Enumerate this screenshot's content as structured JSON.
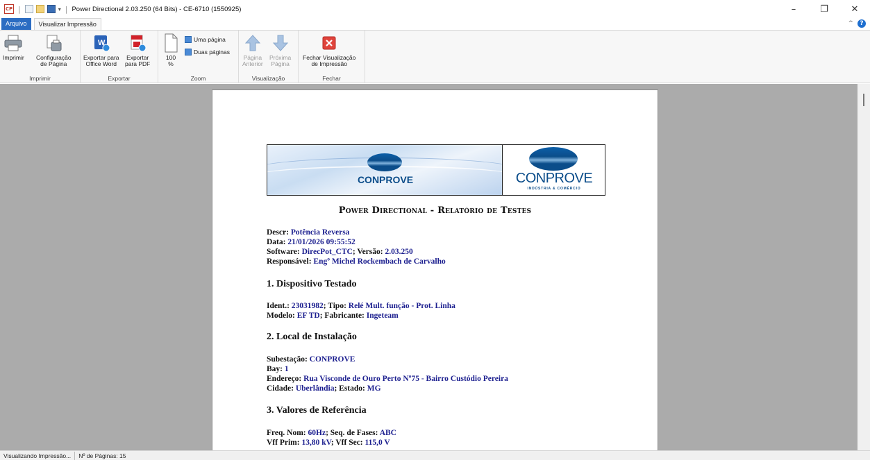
{
  "titlebar": {
    "app_icon_text": "CP",
    "title": "Power Directional 2.03.250 (64 Bits) - CE-6710 (1550925)",
    "minimize": "–",
    "restore": "❐",
    "close": "✕"
  },
  "tabs": {
    "file": "Arquivo",
    "active": "Visualizar Impressão"
  },
  "ribbon": {
    "print_group": {
      "label": "Imprimir",
      "print": "Imprimir",
      "page_config_1": "Configuração",
      "page_config_2": "de Página"
    },
    "export_group": {
      "label": "Exportar",
      "word_1": "Exportar para",
      "word_2": "Office Word",
      "pdf_1": "Exportar",
      "pdf_2": "para PDF"
    },
    "zoom_group": {
      "label": "Zoom",
      "zoom_value": "100",
      "zoom_unit": "%",
      "one_page": "Uma página",
      "two_pages": "Duas páginas"
    },
    "view_group": {
      "label": "Visualização",
      "prev_1": "Página",
      "prev_2": "Anterior",
      "next_1": "Próxima",
      "next_2": "Página"
    },
    "close_group": {
      "label": "Fechar",
      "close_1": "Fechar Visualização",
      "close_2": "de Impressão"
    }
  },
  "report": {
    "logo_left": "CONPROVE",
    "logo_right": "CONPROVE",
    "logo_right_sub": "INDÚSTRIA & COMÉRCIO",
    "title": "Power Directional - Relatório de Testes",
    "descr_label": "Descr: ",
    "descr": "Potência Reversa",
    "date_label": "Data: ",
    "date": "21/01/2026 09:55:52",
    "software_label": "Software: ",
    "software": "DirecPot_CTC",
    "version_label": "; Versão: ",
    "version": "2.03.250",
    "resp_label": "Responsável: ",
    "resp": "Engº Michel Rockembach de Carvalho",
    "s1": "1. Dispositivo Testado",
    "ident_label": "Ident.: ",
    "ident": "23031982",
    "tipo_label": "; Tipo: ",
    "tipo": "Relé Mult. função - Prot. Linha",
    "modelo_label": "Modelo: ",
    "modelo": "EF TD",
    "fab_label": "; Fabricante: ",
    "fab": "Ingeteam",
    "s2": "2. Local de Instalação",
    "sub_label": "Subestação: ",
    "sub": "CONPROVE",
    "bay_label": "Bay: ",
    "bay": "1",
    "end_label": "Endereço: ",
    "end": "Rua Visconde de Ouro Perto Nº75 - Bairro Custódio Pereira",
    "cid_label": "Cidade: ",
    "cid": "Uberlândia",
    "est_label": "; Estado: ",
    "est": "MG",
    "s3": "3. Valores de Referência",
    "freq_label": "Freq. Nom: ",
    "freq": "60Hz",
    "seq_label": "; Seq. de Fases: ",
    "seq": "ABC",
    "vffp_label": "Vff Prim: ",
    "vffp": "13,80 kV",
    "vffs_label": "; Vff Sec: ",
    "vffs": "115,0 V"
  },
  "status": {
    "left": "Visualizando Impressão...",
    "pages": "Nº de Páginas: 15"
  }
}
